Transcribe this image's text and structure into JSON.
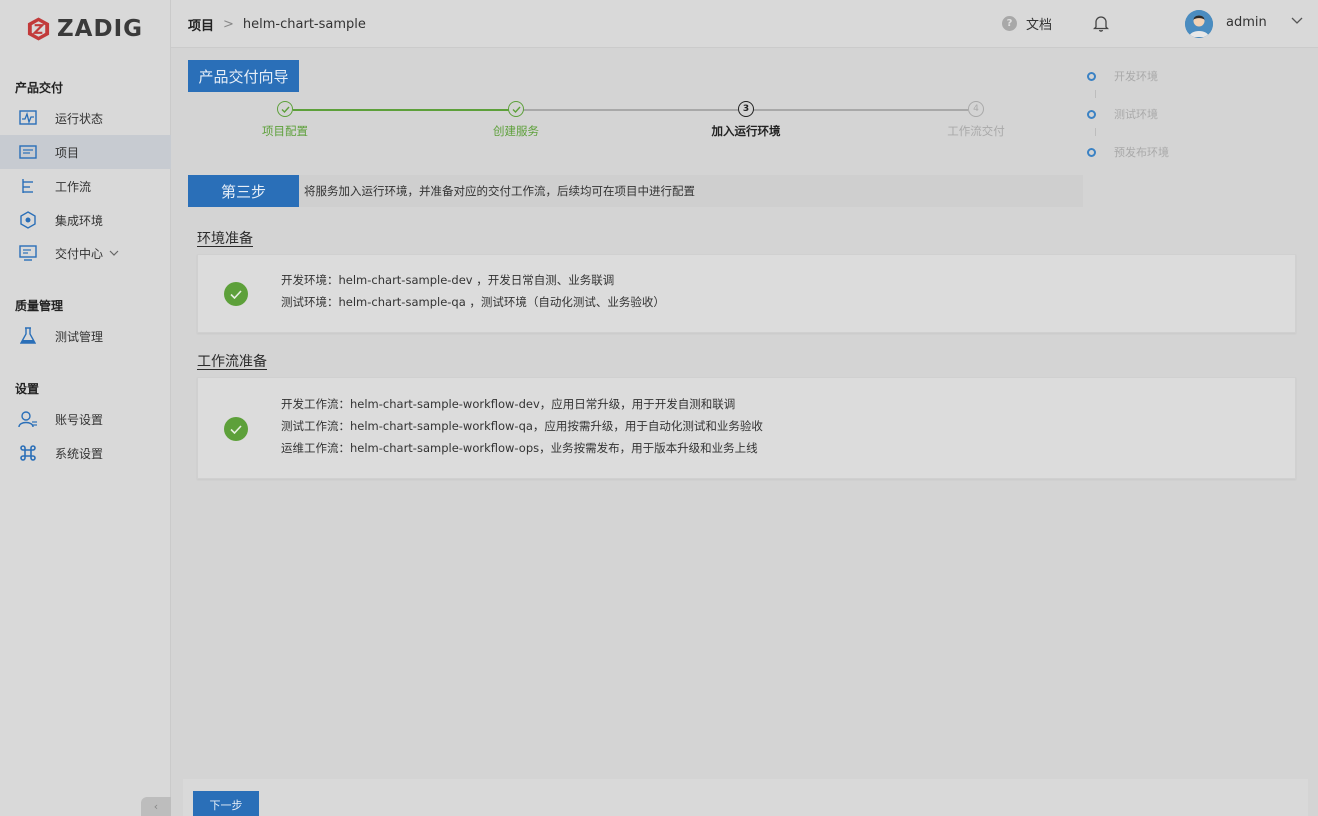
{
  "app": {
    "logo_text": "ZADIG"
  },
  "sidebar": {
    "groups": [
      {
        "title": "产品交付"
      },
      {
        "title": "质量管理"
      },
      {
        "title": "设置"
      }
    ],
    "items": [
      {
        "label": "运行状态",
        "icon": "monitor-pulse-icon"
      },
      {
        "label": "项目",
        "icon": "folder-list-icon",
        "active": true
      },
      {
        "label": "工作流",
        "icon": "workflow-tree-icon"
      },
      {
        "label": "集成环境",
        "icon": "cube-network-icon"
      },
      {
        "label": "交付中心",
        "icon": "delivery-screen-icon",
        "has_submenu": true
      },
      {
        "label": "测试管理",
        "icon": "flask-icon"
      },
      {
        "label": "账号设置",
        "icon": "user-settings-icon"
      },
      {
        "label": "系统设置",
        "icon": "command-icon"
      }
    ],
    "collapse_icon": "chevron-left-icon"
  },
  "header": {
    "breadcrumb_root": "项目",
    "breadcrumb_sep": ">",
    "breadcrumb_current": "helm-chart-sample",
    "docs_label": "文档",
    "docs_icon_glyph": "?",
    "username": "admin"
  },
  "guide": {
    "title": "产品交付向导",
    "steps": [
      {
        "label": "项目配置",
        "status": "done"
      },
      {
        "label": "创建服务",
        "status": "done"
      },
      {
        "label": "加入运行环境",
        "status": "current",
        "number": "3"
      },
      {
        "label": "工作流交付",
        "status": "pending",
        "number": "4"
      }
    ],
    "env_steps": [
      {
        "label": "开发环境"
      },
      {
        "label": "测试环境"
      },
      {
        "label": "预发布环境"
      }
    ],
    "step_button": "第三步",
    "step_desc": "将服务加入运行环境，并准备对应的交付工作流，后续均可在项目中进行配置"
  },
  "env_section": {
    "title": "环境准备",
    "lines": [
      "开发环境：helm-chart-sample-dev ，开发日常自测、业务联调",
      "测试环境：helm-chart-sample-qa ，测试环境（自动化测试、业务验收）"
    ]
  },
  "workflow_section": {
    "title": "工作流准备",
    "lines": [
      "开发工作流：helm-chart-sample-workflow-dev，应用日常升级，用于开发自测和联调",
      "测试工作流：helm-chart-sample-workflow-qa，应用按需升级，用于自动化测试和业务验收",
      "运维工作流：helm-chart-sample-workflow-ops，业务按需发布，用于版本升级和业务上线"
    ]
  },
  "footer": {
    "next_label": "下一步"
  },
  "colors": {
    "primary": "#2a6fb8",
    "success": "#5da03a",
    "step_done": "#5da03a",
    "step_current": "#222222",
    "step_pending": "#a9a9a9"
  }
}
